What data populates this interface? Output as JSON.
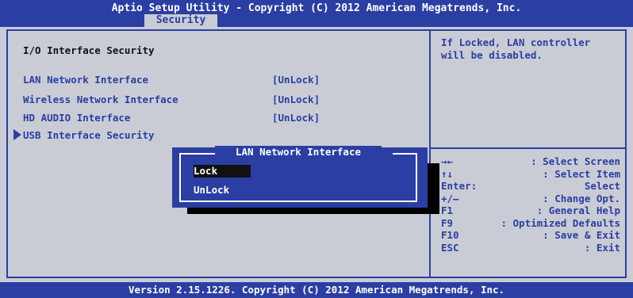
{
  "header": {
    "title": "Aptio Setup Utility - Copyright (C) 2012 American Megatrends, Inc.",
    "active_tab": "Security"
  },
  "main": {
    "section_title": "I/O Interface Security",
    "items": [
      {
        "label": "LAN Network Interface",
        "value": "[UnLock]"
      },
      {
        "label": "Wireless Network Interface",
        "value": "[UnLock]"
      },
      {
        "label": "HD AUDIO Interface",
        "value": "[UnLock]"
      }
    ],
    "submenu": "USB Interface Security"
  },
  "popup": {
    "title": "LAN Network Interface",
    "options": [
      "Lock",
      "UnLock"
    ],
    "selected": "Lock"
  },
  "help": {
    "line1": "If Locked, LAN controller",
    "line2": "will be disabled."
  },
  "keys": [
    {
      "key": "→←",
      "desc": ": Select Screen"
    },
    {
      "key": "↑↓",
      "desc": ": Select Item"
    },
    {
      "key": "Enter:",
      "desc": "Select"
    },
    {
      "key": "+/—",
      "desc": ": Change Opt."
    },
    {
      "key": "F1",
      "desc": ": General Help"
    },
    {
      "key": "F9",
      "desc": ": Optimized Defaults"
    },
    {
      "key": "F10",
      "desc": ": Save & Exit"
    },
    {
      "key": "ESC",
      "desc": ": Exit"
    }
  ],
  "footer": "Version 2.15.1226. Copyright (C) 2012 American Megatrends, Inc.",
  "colors": {
    "bios_blue": "#2b3ea3",
    "panel_gray": "#c9ccd4",
    "text_white": "#ffffff",
    "highlight_black": "#111111"
  }
}
